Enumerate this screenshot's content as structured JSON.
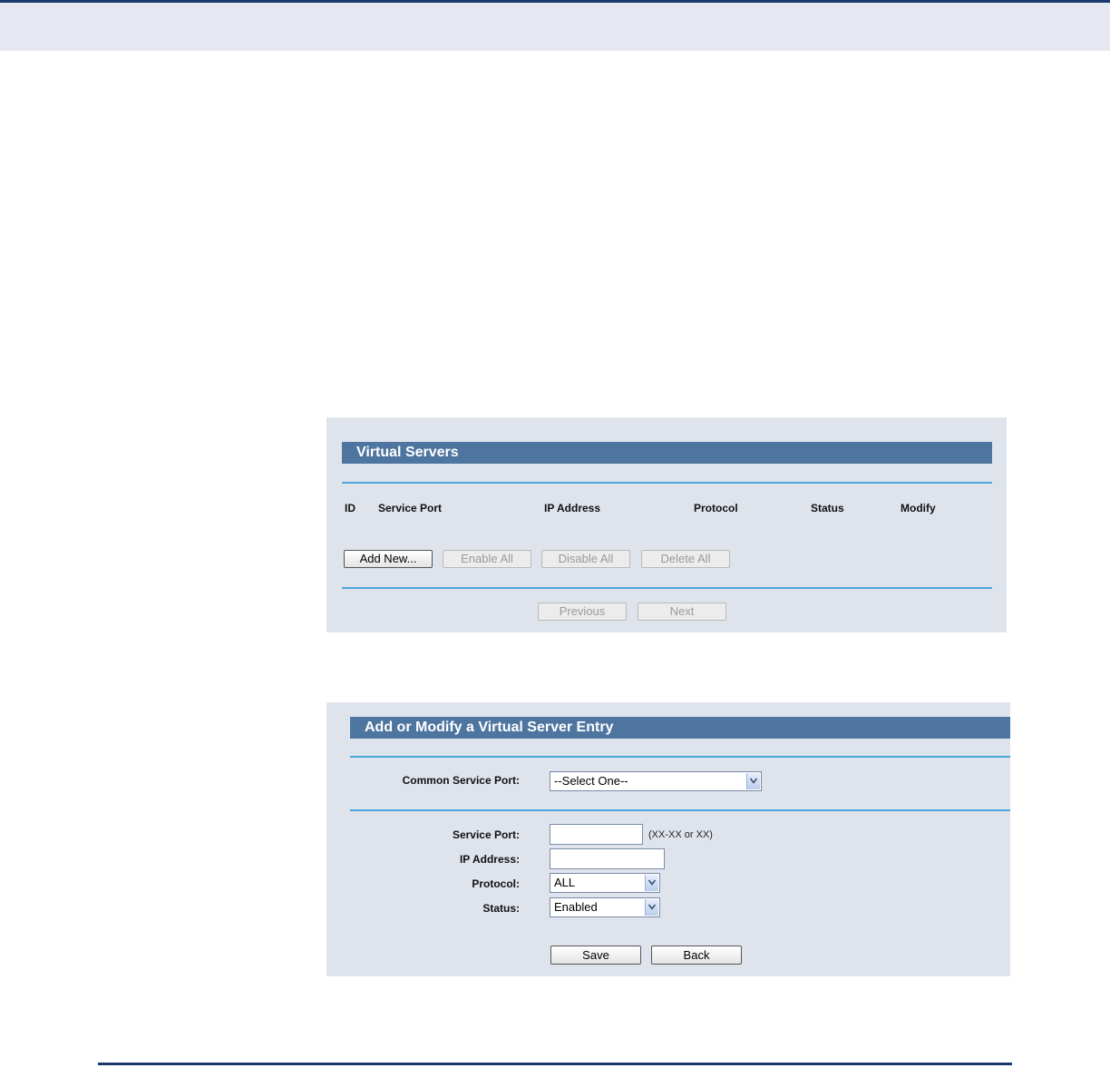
{
  "virtual_servers": {
    "title": "Virtual Servers",
    "columns": [
      "ID",
      "Service Port",
      "IP Address",
      "Protocol",
      "Status",
      "Modify"
    ],
    "buttons": {
      "add_new": "Add New...",
      "enable_all": "Enable All",
      "disable_all": "Disable All",
      "delete_all": "Delete All",
      "previous": "Previous",
      "next": "Next"
    }
  },
  "entry_form": {
    "title": "Add or Modify a Virtual Server Entry",
    "common_service_port": {
      "label": "Common Service Port:",
      "selected": "--Select One--"
    },
    "service_port": {
      "label": "Service Port:",
      "value": "",
      "hint": "(XX-XX or XX)"
    },
    "ip_address": {
      "label": "IP Address:",
      "value": ""
    },
    "protocol": {
      "label": "Protocol:",
      "selected": "ALL"
    },
    "status": {
      "label": "Status:",
      "selected": "Enabled"
    },
    "buttons": {
      "save": "Save",
      "back": "Back"
    }
  },
  "colors": {
    "title_bar": "#4e75a0",
    "panel_bg": "#dfe4ec",
    "divider": "#4aa8dc",
    "page_rule": "#1a3a6b"
  }
}
